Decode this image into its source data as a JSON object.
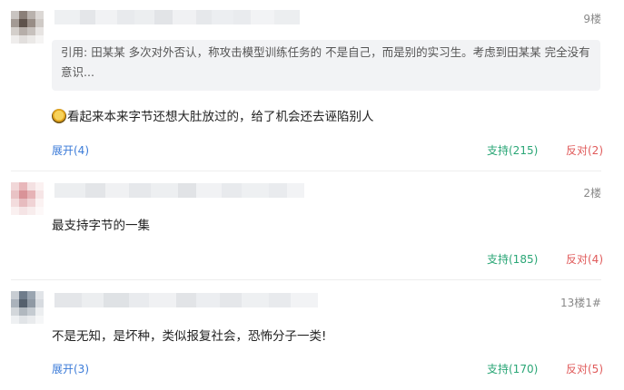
{
  "comments": [
    {
      "floor": "9楼",
      "quote": {
        "prefix": "引用:",
        "text": "田某某 多次对外否认，称攻击模型训练任务的 不是自己，而是别的实习生。考虑到田某某 完全没有意识..."
      },
      "text": "看起来本来字节还想大肚放过的，给了机会还去诬陷别人",
      "expand": "展开(4)",
      "support": "支持(215)",
      "oppose": "反对(2)"
    },
    {
      "floor": "2楼",
      "text": "最支持字节的一集",
      "support": "支持(185)",
      "oppose": "反对(4)"
    },
    {
      "floor": "13楼1#",
      "text": "不是无知，是坏种，类似报复社会，恐怖分子一类!",
      "expand": "展开(3)",
      "support": "支持(170)",
      "oppose": "反对(5)"
    }
  ],
  "colors": {
    "link": "#3b7bd8",
    "support": "#2aa676",
    "oppose": "#e05a5a",
    "quote_bg": "#f2f3f5"
  },
  "icons": {
    "emoji": "laughing-face-emoji"
  }
}
